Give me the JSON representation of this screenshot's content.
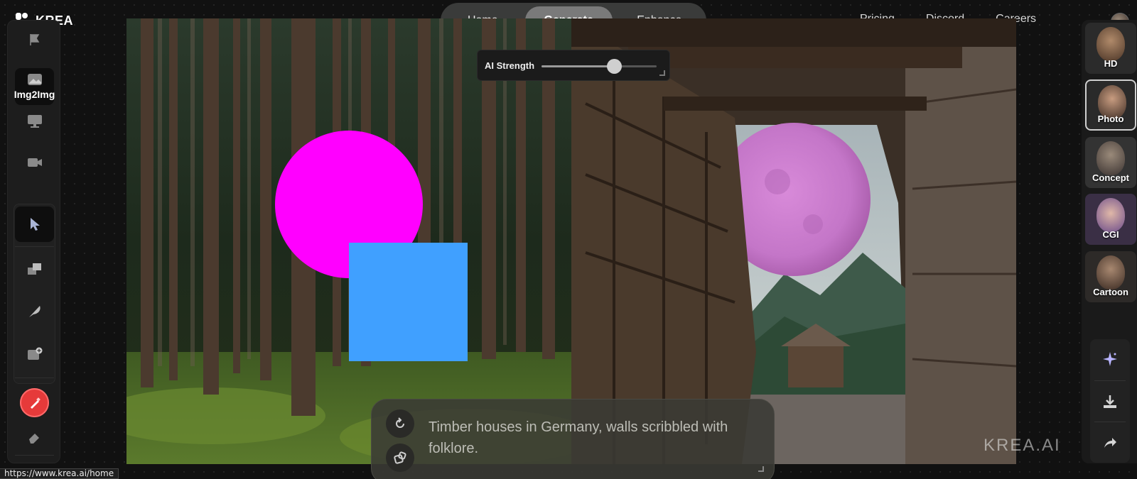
{
  "brand": {
    "name": "KREA",
    "watermark": "KREA.AI"
  },
  "nav": {
    "tabs": [
      {
        "label": "Home",
        "active": false
      },
      {
        "label": "Generate",
        "active": true
      },
      {
        "label": "Enhance",
        "active": false
      }
    ],
    "links": [
      "Pricing",
      "Discord",
      "Careers"
    ]
  },
  "left_toolbar": {
    "items": [
      {
        "name": "img2img",
        "label": "Img2Img",
        "icon": "image-icon",
        "active": true
      },
      {
        "name": "realtime",
        "icon": "monitor-icon"
      },
      {
        "name": "video",
        "icon": "video-camera-icon"
      },
      {
        "name": "select",
        "icon": "cursor-arrow-icon",
        "active": true
      },
      {
        "name": "shapes",
        "icon": "layers-icon"
      },
      {
        "name": "pen",
        "icon": "feather-icon"
      },
      {
        "name": "add-image",
        "icon": "image-plus-icon"
      },
      {
        "name": "brush",
        "icon": "brush-icon"
      },
      {
        "name": "eraser",
        "icon": "eraser-icon"
      }
    ]
  },
  "ai_strength": {
    "label": "AI Strength",
    "value": 0.65
  },
  "styles": [
    {
      "label": "HD",
      "selected": false
    },
    {
      "label": "Photo",
      "selected": true
    },
    {
      "label": "Concept",
      "selected": false
    },
    {
      "label": "CGI",
      "selected": false
    },
    {
      "label": "Cartoon",
      "selected": false
    }
  ],
  "actions": [
    "sparkle-icon",
    "download-icon",
    "share-icon"
  ],
  "prompt": {
    "text": "Timber houses in Germany, walls scribbled with folklore."
  },
  "status_bar": {
    "url": "https://www.krea.ai/home"
  },
  "colors": {
    "magenta": "#ff00ff",
    "blue": "#40a0ff",
    "accent_red": "#e63a3a"
  }
}
